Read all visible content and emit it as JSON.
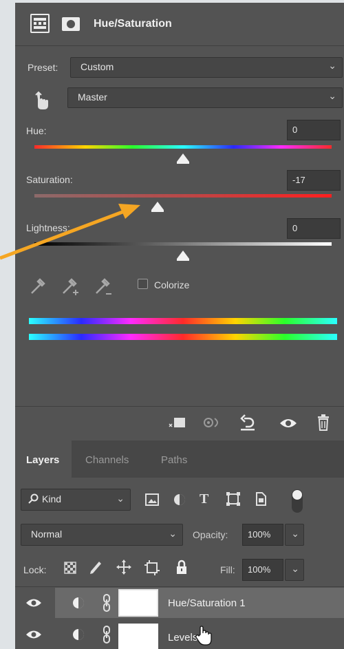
{
  "properties": {
    "title": "Hue/Saturation",
    "preset_label": "Preset:",
    "preset_value": "Custom",
    "channel_value": "Master",
    "hue_label": "Hue:",
    "hue_value": "0",
    "hue_level_percent": 50,
    "saturation_label": "Saturation:",
    "saturation_value": "-17",
    "saturation_level_percent": 41.5,
    "lightness_label": "Lightness:",
    "lightness_value": "0",
    "lightness_level_percent": 50,
    "colorize_label": "Colorize",
    "colorize_checked": false
  },
  "annotation": {
    "arrow_color": "#f5a623"
  },
  "layers_panel": {
    "tabs": [
      "Layers",
      "Channels",
      "Paths"
    ],
    "filter_label": "Kind",
    "blend_mode": "Normal",
    "opacity_label": "Opacity:",
    "opacity_value": "100%",
    "lock_label": "Lock:",
    "fill_label": "Fill:",
    "fill_value": "100%",
    "layers": [
      {
        "name": "Hue/Saturation 1",
        "selected": true
      },
      {
        "name": "Levels",
        "selected": false
      }
    ]
  }
}
